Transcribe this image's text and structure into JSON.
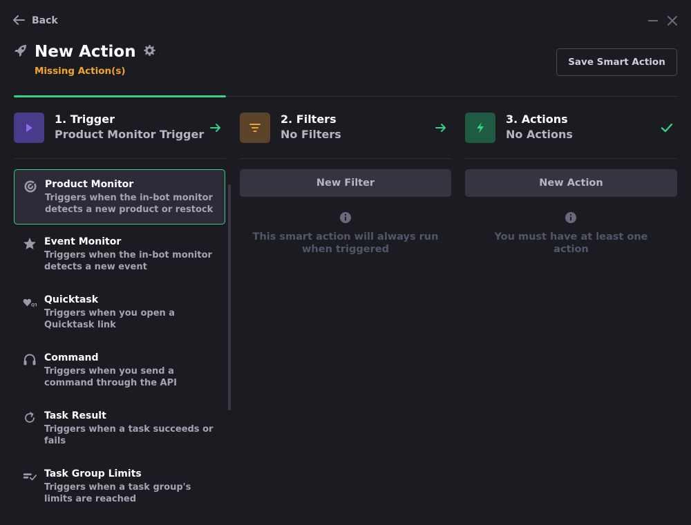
{
  "topbar": {
    "back_label": "Back"
  },
  "header": {
    "title": "New Action",
    "status": "Missing Action(s)",
    "save_label": "Save Smart Action"
  },
  "steps": [
    {
      "number_label": "1. Trigger",
      "value": "Product Monitor Trigger",
      "color": "#4a3a8a",
      "icon": "play-icon"
    },
    {
      "number_label": "2. Filters",
      "value": "No Filters",
      "color": "#5a4328",
      "icon": "filter-icon"
    },
    {
      "number_label": "3. Actions",
      "value": "No Actions",
      "color": "#1f5a42",
      "icon": "bolt-icon"
    }
  ],
  "triggers": [
    {
      "name": "Product Monitor",
      "desc": "Triggers when the in-bot monitor detects a new product or restock",
      "icon": "monitor-icon"
    },
    {
      "name": "Event Monitor",
      "desc": "Triggers when the in-bot monitor detects a new event",
      "icon": "star-icon"
    },
    {
      "name": "Quicktask",
      "desc": "Triggers when you open a Quicktask link",
      "icon": "quicktask-icon"
    },
    {
      "name": "Command",
      "desc": "Triggers when you send a command through the API",
      "icon": "headset-icon"
    },
    {
      "name": "Task Result",
      "desc": "Triggers when a task succeeds or fails",
      "icon": "refresh-icon"
    },
    {
      "name": "Task Group Limits",
      "desc": "Triggers when a task group's limits are reached",
      "icon": "limits-icon"
    }
  ],
  "filters_col": {
    "button": "New Filter",
    "note": "This smart action will always run when triggered"
  },
  "actions_col": {
    "button": "New Action",
    "note": "You must have at least one action"
  },
  "colors": {
    "accent": "#35d483",
    "warning": "#f5a524",
    "background": "#1b1b22"
  }
}
